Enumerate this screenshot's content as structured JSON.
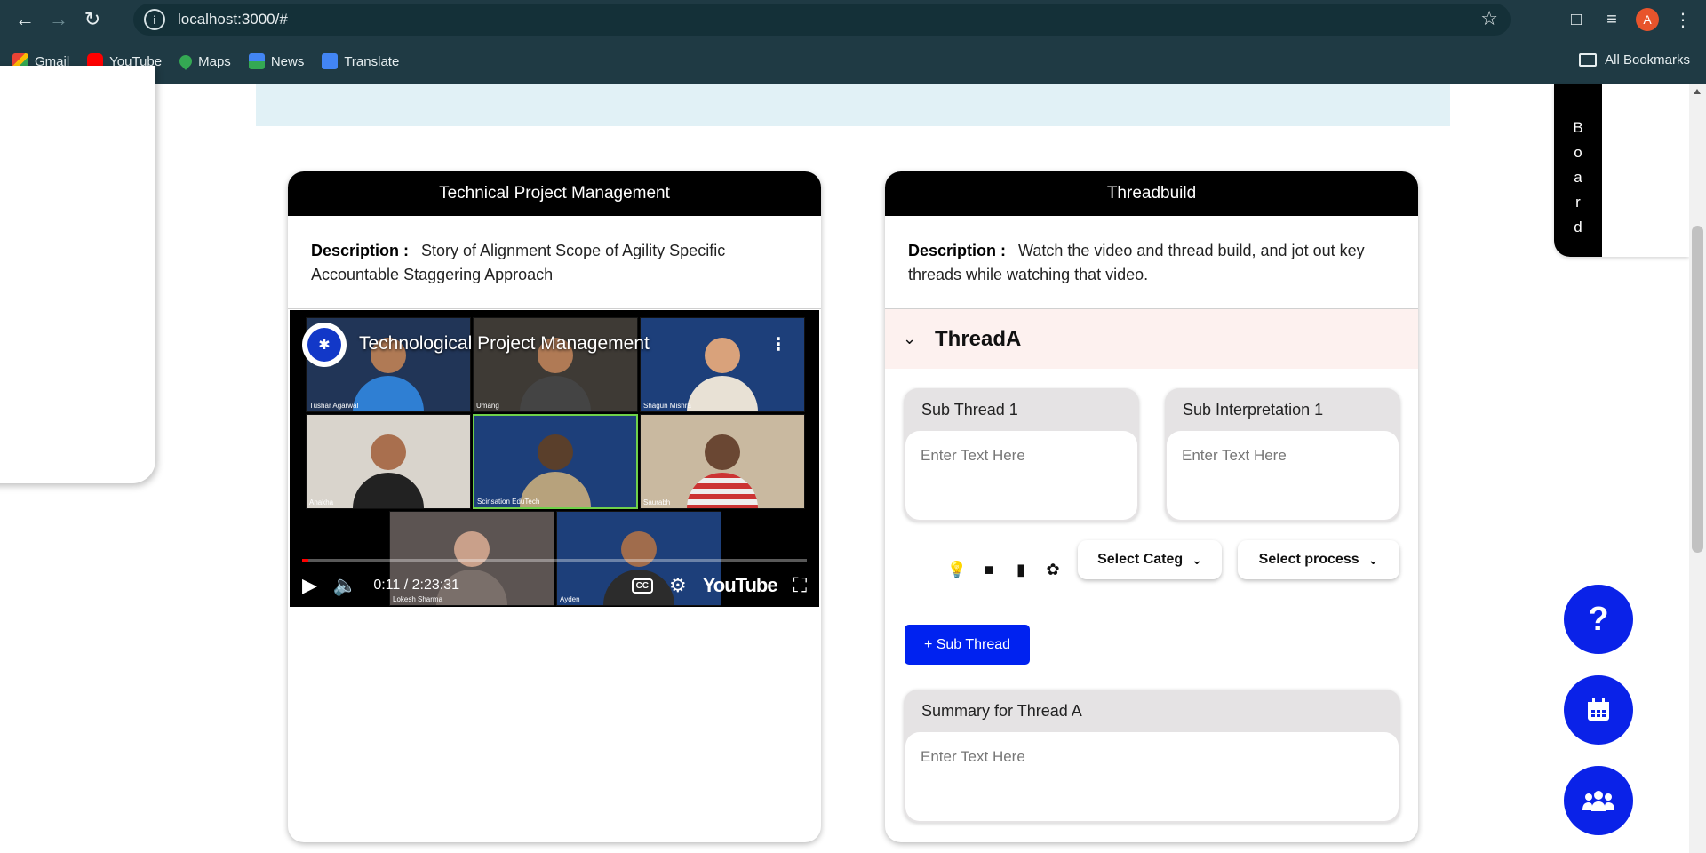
{
  "browser": {
    "url": "localhost:3000/#",
    "profile_initial": "A",
    "bookmarks": [
      "Gmail",
      "YouTube",
      "Maps",
      "News",
      "Translate"
    ],
    "all_bookmarks": "All Bookmarks"
  },
  "board_tab": {
    "letters": [
      "B",
      "o",
      "a",
      "r",
      "d"
    ]
  },
  "left_card": {
    "title": "Technical Project Management",
    "desc_label": "Description :",
    "desc_text": "Story of Alignment Scope of Agility Specific Accountable Staggering Approach",
    "video": {
      "title": "Technological Project Management",
      "time": "0:11 / 2:23:31",
      "platform": "YouTube",
      "participants": [
        "Tushar Agarwal",
        "Umang",
        "Shagun Mishra",
        "Anakha",
        "Scinsation EduTech",
        "Saurabh",
        "Lokesh Sharma",
        "Ayden"
      ],
      "progress": 0.013
    }
  },
  "right_card": {
    "title": "Threadbuild",
    "desc_label": "Description :",
    "desc_text": "Watch the video and thread build, and jot out key threads while watching that video.",
    "thread_title": "ThreadA",
    "sub_thread_label": "Sub Thread 1",
    "sub_interp_label": "Sub Interpretation 1",
    "placeholder": "Enter Text Here",
    "select_category": "Select Categ",
    "select_process": "Select process",
    "add_sub_thread": "+ Sub Thread",
    "summary_label": "Summary for Thread A"
  },
  "colors": {
    "accent": "#0022f0",
    "header": "#000000",
    "thread_bg": "#fdf1ef",
    "banner": "#e1f1f6"
  }
}
